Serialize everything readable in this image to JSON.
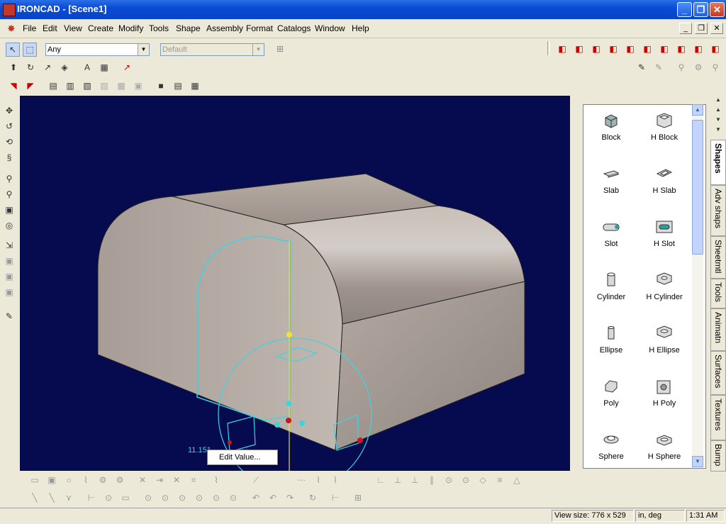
{
  "window": {
    "title": "IRONCAD - [Scene1]",
    "min": "_",
    "max": "❐",
    "close": "✕"
  },
  "menu": {
    "items": [
      "File",
      "Edit",
      "View",
      "Create",
      "Modify",
      "Tools",
      "Shape",
      "Assembly",
      "Format",
      "Catalogs",
      "Window",
      "Help"
    ],
    "mdi": [
      "_",
      "❐",
      "✕"
    ]
  },
  "toolbar": {
    "selection_filter": "Any",
    "style_combo": "Default"
  },
  "viewport": {
    "dimension_value": "11.151"
  },
  "context_menu": {
    "item": "Edit Value..."
  },
  "catalog": {
    "items": [
      {
        "label": "Block",
        "icon": "block-icon"
      },
      {
        "label": "H Block",
        "icon": "h-block-icon"
      },
      {
        "label": "Slab",
        "icon": "slab-icon"
      },
      {
        "label": "H Slab",
        "icon": "h-slab-icon"
      },
      {
        "label": "Slot",
        "icon": "slot-icon"
      },
      {
        "label": "H Slot",
        "icon": "h-slot-icon"
      },
      {
        "label": "Cylinder",
        "icon": "cylinder-icon"
      },
      {
        "label": "H Cylinder",
        "icon": "h-cylinder-icon"
      },
      {
        "label": "Ellipse",
        "icon": "ellipse-icon"
      },
      {
        "label": "H Ellipse",
        "icon": "h-ellipse-icon"
      },
      {
        "label": "Poly",
        "icon": "poly-icon"
      },
      {
        "label": "H Poly",
        "icon": "h-poly-icon"
      },
      {
        "label": "Sphere",
        "icon": "sphere-icon"
      },
      {
        "label": "H Sphere",
        "icon": "h-sphere-icon"
      }
    ],
    "tabs": [
      "Shapes",
      "Adv shaps",
      "Sheetmtl",
      "Tools",
      "Animatn",
      "Surfaces",
      "Textures",
      "Bump"
    ],
    "active_tab": "Shapes"
  },
  "status": {
    "view_size_label": "View size:",
    "view_width": "776",
    "view_sep": "x",
    "view_height": "529",
    "units": "in, deg",
    "time": "1:31 AM"
  },
  "colors": {
    "viewport_bg": "#060a4e",
    "outline": "#3fd3e0",
    "titlebar": "#0a4cd6"
  }
}
